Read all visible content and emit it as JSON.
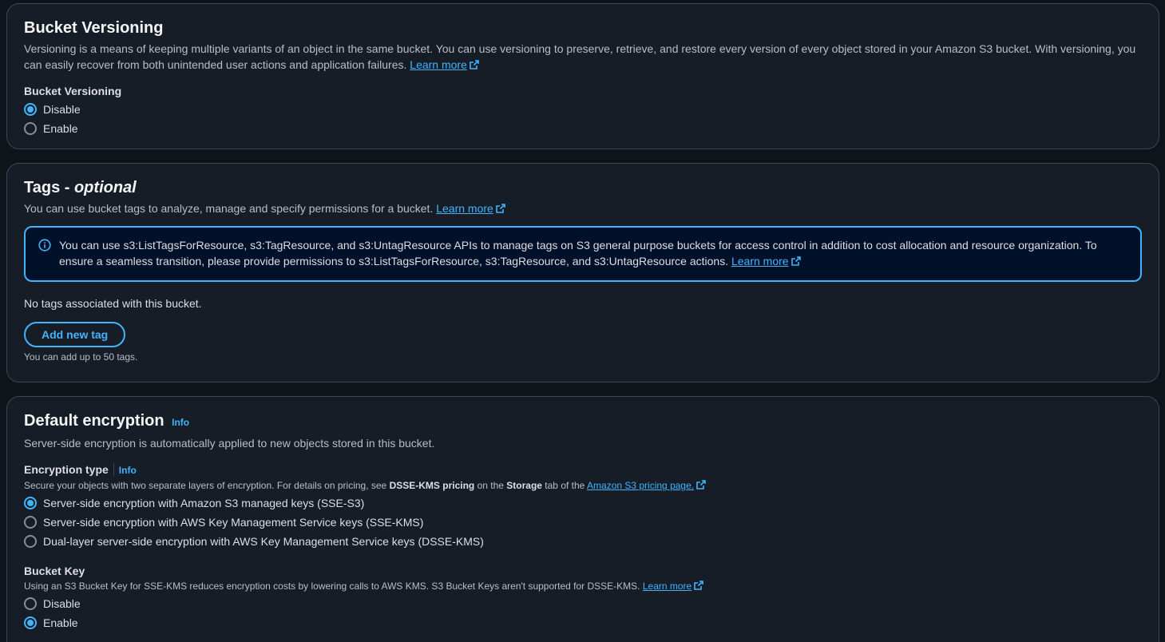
{
  "versioning": {
    "title": "Bucket Versioning",
    "description": "Versioning is a means of keeping multiple variants of an object in the same bucket. You can use versioning to preserve, retrieve, and restore every version of every object stored in your Amazon S3 bucket. With versioning, you can easily recover from both unintended user actions and application failures.",
    "learn_more": "Learn more",
    "field_label": "Bucket Versioning",
    "options": [
      {
        "label": "Disable",
        "selected": true
      },
      {
        "label": "Enable",
        "selected": false
      }
    ]
  },
  "tags": {
    "title": "Tags - ",
    "title_optional": "optional",
    "description": "You can use bucket tags to analyze, manage and specify permissions for a bucket.",
    "learn_more": "Learn more",
    "alert_text": "You can use s3:ListTagsForResource, s3:TagResource, and s3:UntagResource APIs to manage tags on S3 general purpose buckets for access control in addition to cost allocation and resource organization. To ensure a seamless transition, please provide permissions to s3:ListTagsForResource, s3:TagResource, and s3:UntagResource actions.",
    "alert_learn_more": "Learn more",
    "empty_text": "No tags associated with this bucket.",
    "add_button": "Add new tag",
    "limit_text": "You can add up to 50 tags."
  },
  "encryption": {
    "title": "Default encryption",
    "info": "Info",
    "description": "Server-side encryption is automatically applied to new objects stored in this bucket.",
    "type_label": "Encryption type",
    "type_info": "Info",
    "type_desc_1": "Secure your objects with two separate layers of encryption. For details on pricing, see ",
    "type_desc_bold_1": "DSSE-KMS pricing",
    "type_desc_2": " on the ",
    "type_desc_bold_2": "Storage",
    "type_desc_3": " tab of the ",
    "type_desc_link": "Amazon S3 pricing page.",
    "type_options": [
      {
        "label": "Server-side encryption with Amazon S3 managed keys (SSE-S3)",
        "selected": true
      },
      {
        "label": "Server-side encryption with AWS Key Management Service keys (SSE-KMS)",
        "selected": false
      },
      {
        "label": "Dual-layer server-side encryption with AWS Key Management Service keys (DSSE-KMS)",
        "selected": false
      }
    ],
    "bucket_key_label": "Bucket Key",
    "bucket_key_desc": "Using an S3 Bucket Key for SSE-KMS reduces encryption costs by lowering calls to AWS KMS. S3 Bucket Keys aren't supported for DSSE-KMS.",
    "bucket_key_learn_more": "Learn more",
    "bucket_key_options": [
      {
        "label": "Disable",
        "selected": false
      },
      {
        "label": "Enable",
        "selected": true
      }
    ]
  },
  "colors": {
    "background": "#0f141a",
    "panel": "#161d26",
    "border": "#3d4652",
    "accent": "#42b4ff",
    "alert_bg": "#001129"
  }
}
